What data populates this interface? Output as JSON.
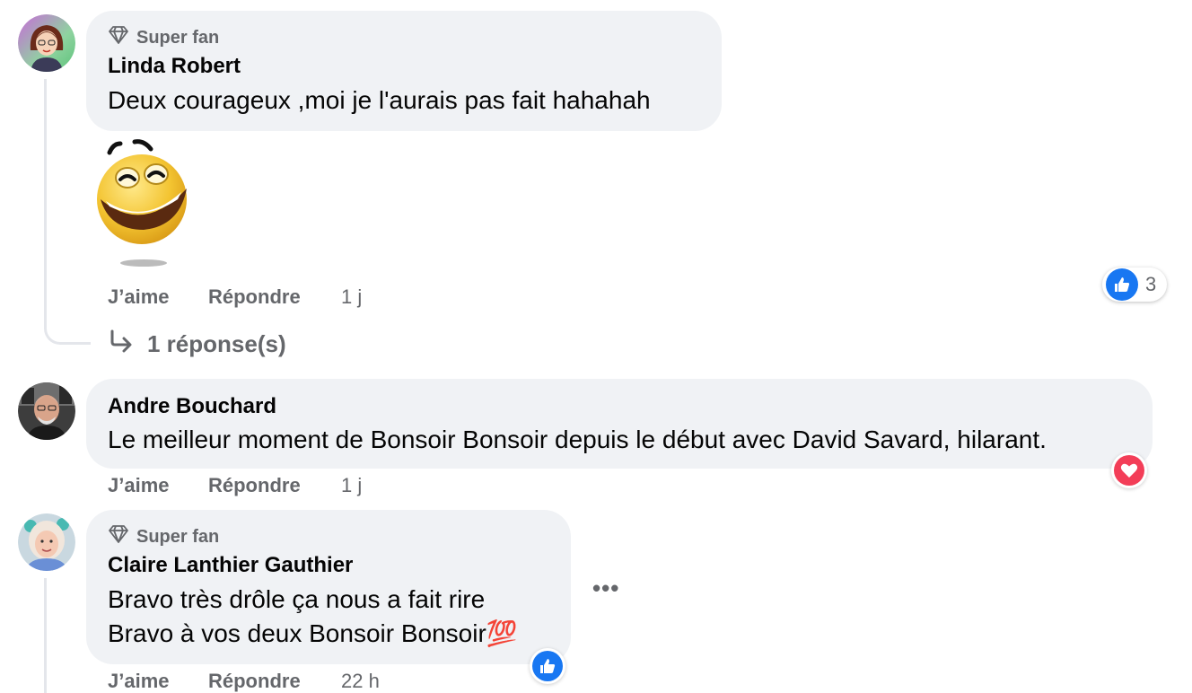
{
  "colors": {
    "bubble": "#f0f2f5",
    "secondary_text": "#65676b",
    "like_blue": "#1877f2",
    "love_red": "#f33e58",
    "thread_line": "#e4e6eb"
  },
  "comments": [
    {
      "badge": "Super fan",
      "author": "Linda Robert",
      "text": "Deux courageux ,moi je l'aurais pas fait hahahah",
      "sticker": "laughing-smiley-sticker",
      "actions": {
        "like": "J’aime",
        "reply": "Répondre",
        "time": "1 j"
      },
      "reaction": {
        "type": "like",
        "count": "3"
      },
      "replies": "1 réponse(s)"
    },
    {
      "author": "Andre Bouchard",
      "text": "Le meilleur moment de Bonsoir Bonsoir depuis le début avec David Savard, hilarant.",
      "actions": {
        "like": "J’aime",
        "reply": "Répondre",
        "time": "1 j"
      },
      "reaction": {
        "type": "love"
      }
    },
    {
      "badge": "Super fan",
      "author": "Claire Lanthier Gauthier",
      "lines": [
        "Bravo très drôle ça nous a fait rire",
        "Bravo à vos deux Bonsoir Bonsoir💯"
      ],
      "more": "•••",
      "actions": {
        "like": "J’aime",
        "reply": "Répondre",
        "time": "22 h"
      },
      "reaction": {
        "type": "like"
      }
    }
  ]
}
